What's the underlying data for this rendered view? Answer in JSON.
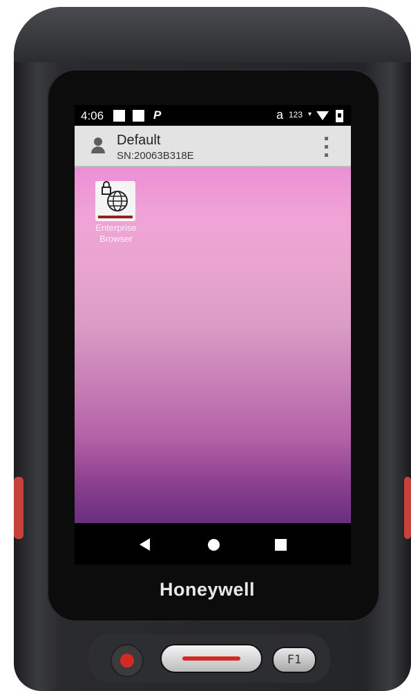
{
  "status_bar": {
    "time": "4:06",
    "notification_glyph": "P",
    "keyboard_mode_a": "a",
    "keyboard_mode_numbers": "123",
    "data_indicator": "▾",
    "icons": [
      "square-notification-icon",
      "square-notification-icon",
      "wifi-icon",
      "battery-icon"
    ]
  },
  "profile_bar": {
    "title": "Default",
    "serial": "SN:20063B318E",
    "icon": "person-icon",
    "menu_icon": "more-vert-icon"
  },
  "home_screen": {
    "apps": [
      {
        "label_line1": "Enterprise",
        "label_line2": "Browser",
        "icon": "globe-lock-icon"
      }
    ]
  },
  "navigation_bar": {
    "buttons": [
      "back-icon",
      "home-icon",
      "recents-icon"
    ]
  },
  "device": {
    "brand": "Honeywell",
    "f1_label": "F1",
    "colors": {
      "accent_red": "#d42a23",
      "body": "#2a2b2e"
    }
  }
}
